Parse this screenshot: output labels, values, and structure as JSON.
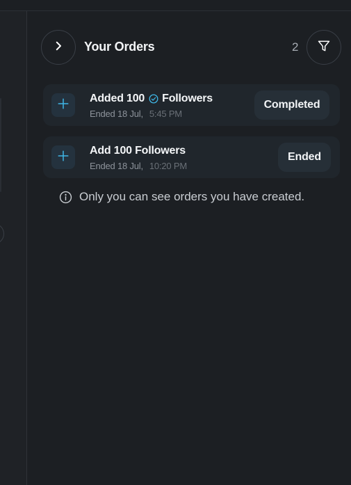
{
  "header": {
    "title": "Your Orders",
    "count": "2",
    "expand_icon": "chevron-right-icon",
    "filter_icon": "filter-icon"
  },
  "orders": [
    {
      "title_before": "Added 100",
      "title_after": "Followers",
      "verified": true,
      "date": "Ended 18 Jul,",
      "time": "5:45 PM",
      "status": "Completed",
      "icon": "plus-icon"
    },
    {
      "title_before": "Add 100 Followers",
      "title_after": "",
      "verified": false,
      "date": "Ended 18 Jul,",
      "time": "10:20 PM",
      "status": "Ended",
      "icon": "plus-icon"
    }
  ],
  "notice": {
    "text": "Only you can see orders you have created.",
    "icon": "info-icon"
  },
  "colors": {
    "background": "#1c1f23",
    "card": "#20262c",
    "accent": "#3fb6e6",
    "pill": "#262f37"
  }
}
